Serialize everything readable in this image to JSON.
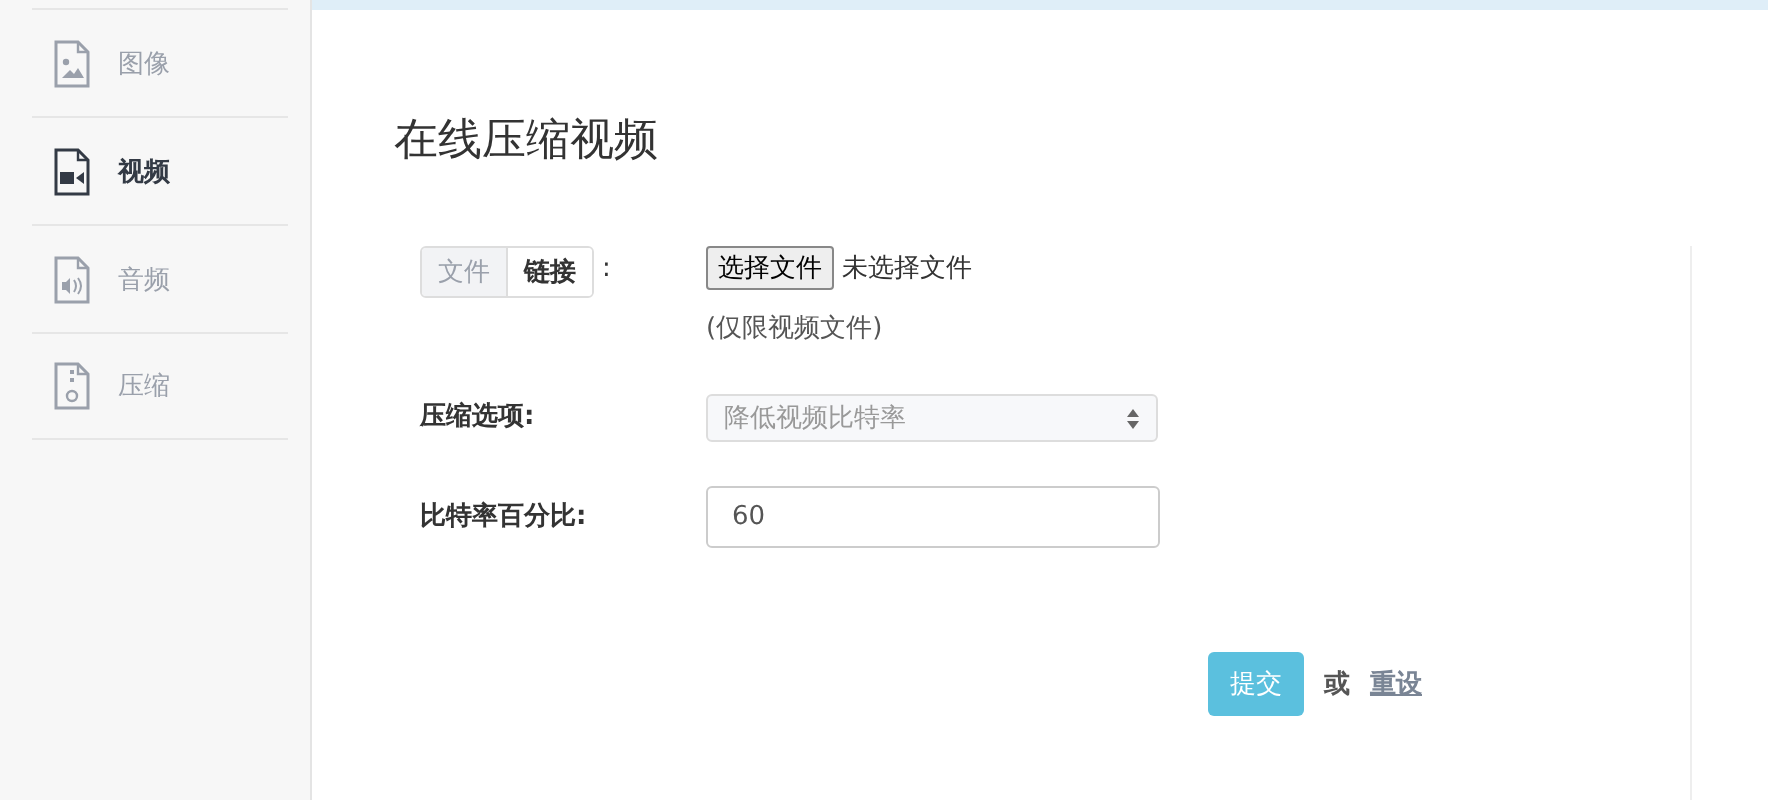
{
  "sidebar": {
    "items": [
      {
        "label": "图像",
        "kind": "image",
        "selected": false
      },
      {
        "label": "视频",
        "kind": "video",
        "selected": true
      },
      {
        "label": "音频",
        "kind": "audio",
        "selected": false
      },
      {
        "label": "压缩",
        "kind": "zip",
        "selected": false
      }
    ]
  },
  "page_title": "在线压缩视频",
  "source": {
    "tabs": [
      {
        "label": "文件",
        "selected": true
      },
      {
        "label": "链接",
        "selected": false
      }
    ],
    "colon": ":",
    "file_button": "选择文件",
    "file_status": "未选择文件",
    "hint": "(仅限视频文件)"
  },
  "compress_option": {
    "label": "压缩选项:",
    "value": "降低视频比特率"
  },
  "bitrate": {
    "label": "比特率百分比:",
    "value": "60"
  },
  "actions": {
    "submit": "提交",
    "or": "或",
    "reset": "重设"
  }
}
